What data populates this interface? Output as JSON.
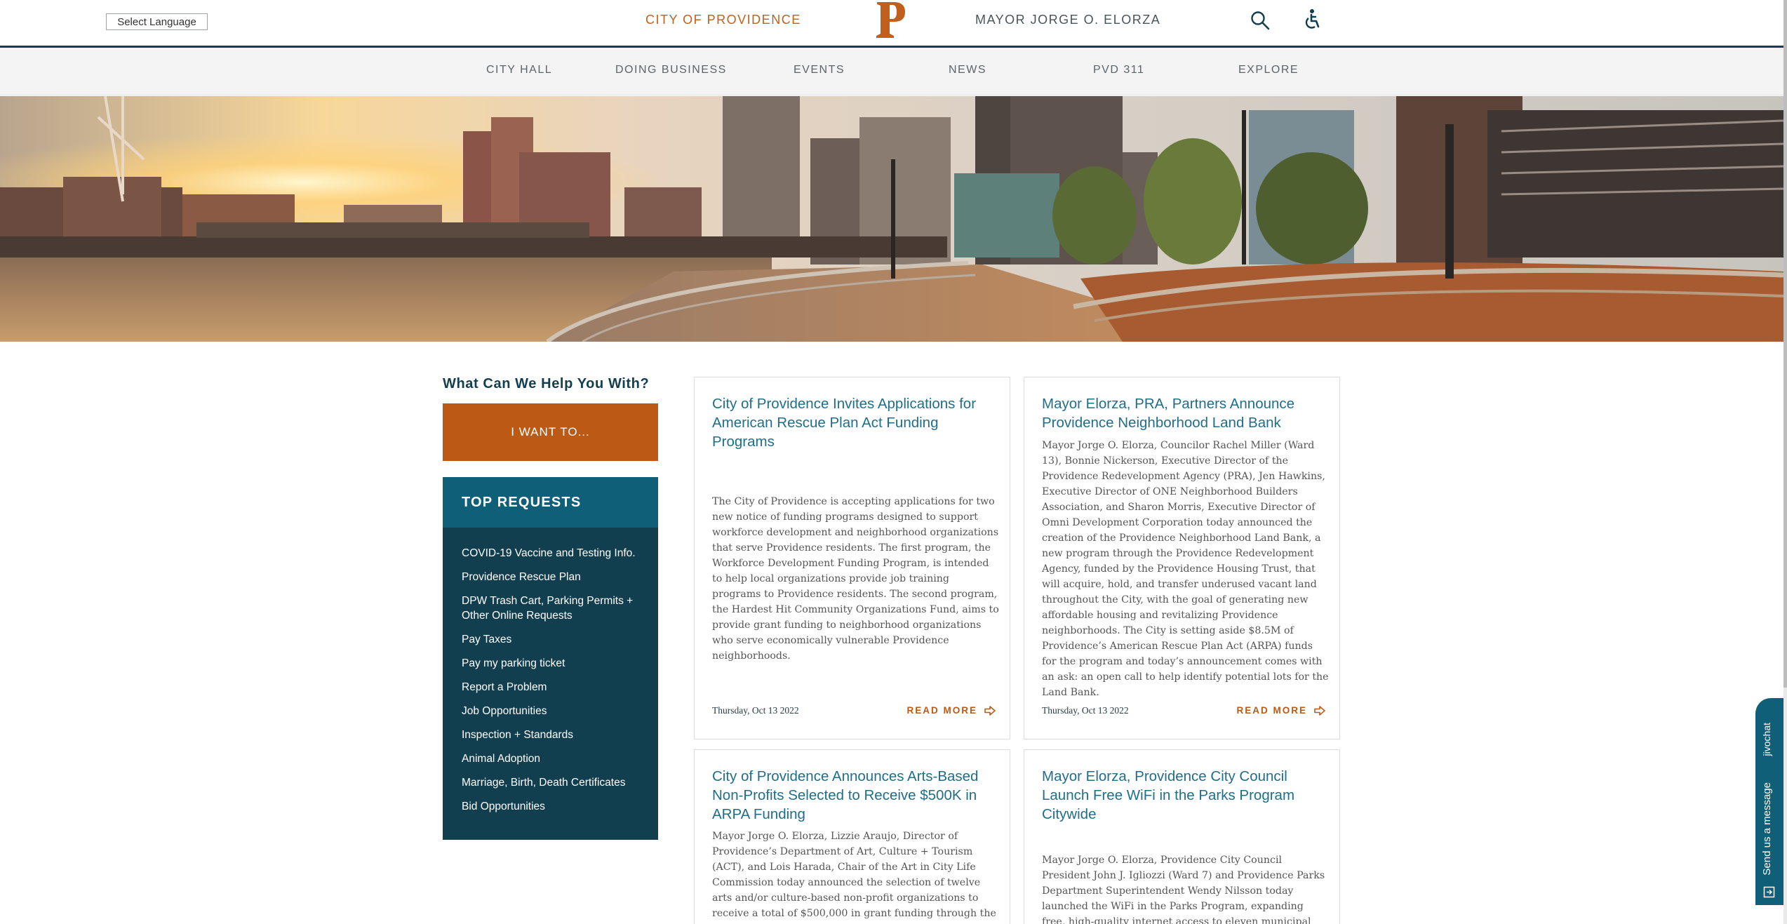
{
  "header": {
    "language_select": "Select Language",
    "city_link": "CITY OF PROVIDENCE",
    "logo_letter": "P",
    "mayor_link": "MAYOR JORGE O. ELORZA",
    "search_icon": "search-icon",
    "accessibility_icon": "wheelchair-icon"
  },
  "colors": {
    "brand_orange": "#bc5a15",
    "navy": "#123f50",
    "teal": "#0f5f78",
    "link_blue": "#1f6e8a"
  },
  "nav": {
    "items": [
      "CITY HALL",
      "DOING BUSINESS",
      "EVENTS",
      "NEWS",
      "PVD 311",
      "EXPLORE"
    ]
  },
  "sidebar": {
    "help_title": "What Can We Help You With?",
    "i_want_button": "I WANT TO...",
    "top_requests_title": "TOP REQUESTS",
    "requests": [
      "COVID-19 Vaccine and Testing Info.",
      "Providence Rescue Plan",
      "DPW Trash Cart, Parking Permits + Other Online Requests",
      "Pay Taxes",
      "Pay my parking ticket",
      "Report a Problem",
      "Job Opportunities",
      "Inspection + Standards",
      "Animal Adoption",
      "Marriage, Birth, Death Certificates",
      "Bid Opportunities"
    ]
  },
  "news": [
    {
      "title": "City of Providence Invites Applications for American Rescue Plan Act Funding Programs",
      "body": "The City of Providence is accepting applications for two new notice of funding programs designed to support workforce development and neighborhood organizations that serve Providence residents. The first program, the Workforce Development Funding Program, is intended to help local organizations provide job training programs to Providence residents. The second program, the Hardest Hit Community Organizations Fund, aims to provide grant funding to neighborhood organizations who serve economically vulnerable Providence neighborhoods.",
      "date": "Thursday, Oct 13 2022",
      "read_more": "READ MORE"
    },
    {
      "title": "Mayor Elorza, PRA, Partners Announce Providence Neighborhood Land Bank",
      "body": "Mayor Jorge O. Elorza, Councilor Rachel Miller (Ward 13), Bonnie Nickerson, Executive Director of the Providence Redevelopment Agency (PRA), Jen Hawkins, Executive Director of ONE Neighborhood Builders Association, and Sharon Morris, Executive Director of Omni Development Corporation today announced the creation of the Providence Neighborhood Land Bank, a new program through the Providence Redevelopment Agency, funded by the Providence Housing Trust, that will acquire, hold, and transfer underused vacant land throughout the City, with the goal of generating new affordable housing and revitalizing Providence neighborhoods. The City is setting aside $8.5M of Providence’s American Rescue Plan Act (ARPA) funds for the program and today’s announcement comes with an ask: an open call to help identify potential lots for the Land Bank.",
      "date": "Thursday, Oct 13 2022",
      "read_more": "READ MORE"
    },
    {
      "title": "City of Providence Announces Arts-Based Non-Profits Selected to Receive $500K in ARPA Funding",
      "body": "Mayor Jorge O. Elorza, Lizzie Araujo, Director of Providence’s Department of Art, Culture + Tourism (ACT), and Lois Harada, Chair of the Art in City Life Commission today announced the selection of twelve arts and/or culture-based non-profit organizations to receive a total of $500,000 in grant funding through the Providence American"
    },
    {
      "title": "Mayor Elorza, Providence City Council Launch Free WiFi in the Parks Program Citywide",
      "body": "Mayor Jorge O. Elorza, Providence City Council President John J. Igliozzi (Ward 7) and Providence Parks Department Superintendent Wendy Nilsson today launched the WiFi in the Parks Program, expanding free, high-quality internet access to eleven municipal parks citywide using Providence"
    }
  ],
  "chat": {
    "brand": "jivochat",
    "message": "Send us a message"
  }
}
